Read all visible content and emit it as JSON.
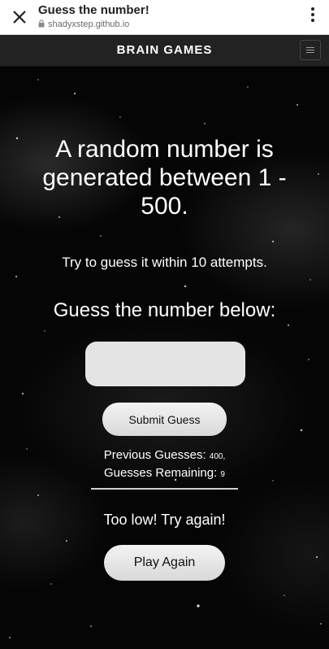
{
  "browser": {
    "tab_title": "Guess the number!",
    "url": "shadyxstep.github.io"
  },
  "navbar": {
    "brand": "BRAIN GAMES"
  },
  "game": {
    "headline": "A random number is generated between 1 - 500.",
    "instructions": "Try to guess it within 10 attempts.",
    "prompt": "Guess the number below:",
    "guess_input": {
      "value": "",
      "placeholder": ""
    },
    "submit_label": "Submit Guess",
    "previous_guesses_label": "Previous Guesses:",
    "previous_guesses_value": "400,",
    "guesses_remaining_label": "Guesses Remaining:",
    "guesses_remaining_value": "9",
    "feedback": "Too low! Try again!",
    "play_again_label": "Play Again"
  },
  "icons": {
    "close": "close-icon",
    "lock": "lock-icon",
    "menu": "more-vert-icon",
    "nav_toggle": "hamburger-icon"
  },
  "colors": {
    "navbar_bg": "#222222",
    "page_bg": "#050505",
    "button_bg": "#e4e4e4",
    "text": "#ffffff"
  }
}
